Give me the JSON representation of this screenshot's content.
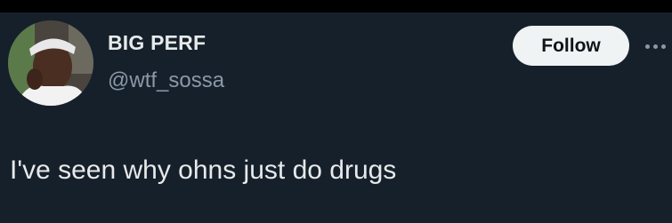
{
  "tweet": {
    "author": {
      "display_name": "BIG PERF",
      "handle": "@wtf_sossa",
      "avatar_icon": "profile-photo"
    },
    "follow_label": "Follow",
    "more_icon": "more-options-icon",
    "text": "I've seen why ohns just do drugs"
  },
  "colors": {
    "background": "#15202b",
    "primary_text": "#e7e9ea",
    "secondary_text": "#8b98a5",
    "follow_button_bg": "#eff3f4",
    "follow_button_text": "#0f1419"
  }
}
